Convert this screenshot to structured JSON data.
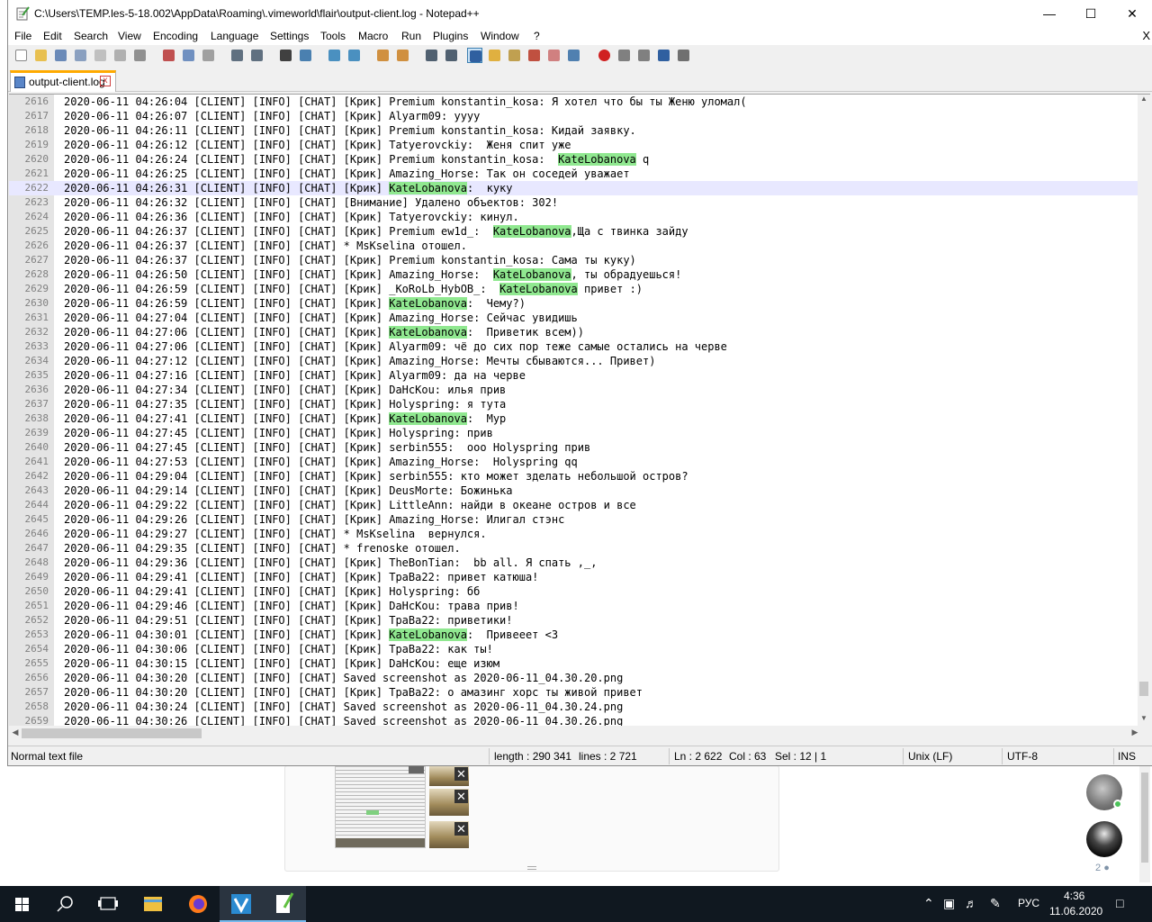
{
  "window": {
    "title": "C:\\Users\\TEMP.les-5-18.002\\AppData\\Roaming\\.vimeworld\\flair\\output-client.log - Notepad++",
    "minimize_glyph": "—",
    "maximize_glyph": "☐",
    "close_glyph": "✕"
  },
  "menu": {
    "items": [
      "File",
      "Edit",
      "Search",
      "View",
      "Encoding",
      "Language",
      "Settings",
      "Tools",
      "Macro",
      "Run",
      "Plugins",
      "Window",
      "?"
    ],
    "close_glyph": "X"
  },
  "tab": {
    "label": "output-client.log",
    "close_glyph": "x"
  },
  "editor": {
    "current_line": "2622",
    "lines": [
      {
        "n": "2616",
        "pre": "2020-06-11 04:26:04 [CLIENT] [INFO] [CHAT] [Крик] Premium konstantin_kosa: Я хотел что бы ты Женю уломал(",
        "hl": "",
        "post": ""
      },
      {
        "n": "2617",
        "pre": "2020-06-11 04:26:07 [CLIENT] [INFO] [CHAT] [Крик] Alyarm09: уууу",
        "hl": "",
        "post": ""
      },
      {
        "n": "2618",
        "pre": "2020-06-11 04:26:11 [CLIENT] [INFO] [CHAT] [Крик] Premium konstantin_kosa: Кидай заявку.",
        "hl": "",
        "post": ""
      },
      {
        "n": "2619",
        "pre": "2020-06-11 04:26:12 [CLIENT] [INFO] [CHAT] [Крик] Tatyerovckiy:  Женя спит уже",
        "hl": "",
        "post": ""
      },
      {
        "n": "2620",
        "pre": "2020-06-11 04:26:24 [CLIENT] [INFO] [CHAT] [Крик] Premium konstantin_kosa:  ",
        "hl": "KateLobanova",
        "post": " q"
      },
      {
        "n": "2621",
        "pre": "2020-06-11 04:26:25 [CLIENT] [INFO] [CHAT] [Крик] Amazing_Horse: Так он соседей уважает",
        "hl": "",
        "post": ""
      },
      {
        "n": "2622",
        "pre": "2020-06-11 04:26:31 [CLIENT] [INFO] [CHAT] [Крик] ",
        "hl": "KateLobanova",
        "post": ":  куку"
      },
      {
        "n": "2623",
        "pre": "2020-06-11 04:26:32 [CLIENT] [INFO] [CHAT] [Внимание] Удалено объектов: 302!",
        "hl": "",
        "post": ""
      },
      {
        "n": "2624",
        "pre": "2020-06-11 04:26:36 [CLIENT] [INFO] [CHAT] [Крик] Tatyerovckiy: кинул.",
        "hl": "",
        "post": ""
      },
      {
        "n": "2625",
        "pre": "2020-06-11 04:26:37 [CLIENT] [INFO] [CHAT] [Крик] Premium ew1d_:  ",
        "hl": "KateLobanova",
        "post": ",Ща с твинка зайду"
      },
      {
        "n": "2626",
        "pre": "2020-06-11 04:26:37 [CLIENT] [INFO] [CHAT] * MsKselina отошел.",
        "hl": "",
        "post": ""
      },
      {
        "n": "2627",
        "pre": "2020-06-11 04:26:37 [CLIENT] [INFO] [CHAT] [Крик] Premium konstantin_kosa: Сама ты куку)",
        "hl": "",
        "post": ""
      },
      {
        "n": "2628",
        "pre": "2020-06-11 04:26:50 [CLIENT] [INFO] [CHAT] [Крик] Amazing_Horse:  ",
        "hl": "KateLobanova",
        "post": ", ты обрадуешься!"
      },
      {
        "n": "2629",
        "pre": "2020-06-11 04:26:59 [CLIENT] [INFO] [CHAT] [Крик] _KoRoLb_HybOB_:  ",
        "hl": "KateLobanova",
        "post": " привет :)"
      },
      {
        "n": "2630",
        "pre": "2020-06-11 04:26:59 [CLIENT] [INFO] [CHAT] [Крик] ",
        "hl": "KateLobanova",
        "post": ":  Чему?)"
      },
      {
        "n": "2631",
        "pre": "2020-06-11 04:27:04 [CLIENT] [INFO] [CHAT] [Крик] Amazing_Horse: Сейчас увидишь",
        "hl": "",
        "post": ""
      },
      {
        "n": "2632",
        "pre": "2020-06-11 04:27:06 [CLIENT] [INFO] [CHAT] [Крик] ",
        "hl": "KateLobanova",
        "post": ":  Приветик всем))"
      },
      {
        "n": "2633",
        "pre": "2020-06-11 04:27:06 [CLIENT] [INFO] [CHAT] [Крик] Alyarm09: чё до сих пор теже самые остались на черве",
        "hl": "",
        "post": ""
      },
      {
        "n": "2634",
        "pre": "2020-06-11 04:27:12 [CLIENT] [INFO] [CHAT] [Крик] Amazing_Horse: Мечты сбываются... Привет)",
        "hl": "",
        "post": ""
      },
      {
        "n": "2635",
        "pre": "2020-06-11 04:27:16 [CLIENT] [INFO] [CHAT] [Крик] Alyarm09: да на черве",
        "hl": "",
        "post": ""
      },
      {
        "n": "2636",
        "pre": "2020-06-11 04:27:34 [CLIENT] [INFO] [CHAT] [Крик] DaHcKou: илья прив",
        "hl": "",
        "post": ""
      },
      {
        "n": "2637",
        "pre": "2020-06-11 04:27:35 [CLIENT] [INFO] [CHAT] [Крик] Holyspring: я тута",
        "hl": "",
        "post": ""
      },
      {
        "n": "2638",
        "pre": "2020-06-11 04:27:41 [CLIENT] [INFO] [CHAT] [Крик] ",
        "hl": "KateLobanova",
        "post": ":  Мур"
      },
      {
        "n": "2639",
        "pre": "2020-06-11 04:27:45 [CLIENT] [INFO] [CHAT] [Крик] Holyspring: прив",
        "hl": "",
        "post": ""
      },
      {
        "n": "2640",
        "pre": "2020-06-11 04:27:45 [CLIENT] [INFO] [CHAT] [Крик] serbin555:  ооо Holyspring прив",
        "hl": "",
        "post": ""
      },
      {
        "n": "2641",
        "pre": "2020-06-11 04:27:53 [CLIENT] [INFO] [CHAT] [Крик] Amazing_Horse:  Holyspring qq",
        "hl": "",
        "post": ""
      },
      {
        "n": "2642",
        "pre": "2020-06-11 04:29:04 [CLIENT] [INFO] [CHAT] [Крик] serbin555: кто может зделать небольшой остров?",
        "hl": "",
        "post": ""
      },
      {
        "n": "2643",
        "pre": "2020-06-11 04:29:14 [CLIENT] [INFO] [CHAT] [Крик] DeusMorte: Божинька",
        "hl": "",
        "post": ""
      },
      {
        "n": "2644",
        "pre": "2020-06-11 04:29:22 [CLIENT] [INFO] [CHAT] [Крик] LittleAnn: найди в океане остров и все",
        "hl": "",
        "post": ""
      },
      {
        "n": "2645",
        "pre": "2020-06-11 04:29:26 [CLIENT] [INFO] [CHAT] [Крик] Amazing_Horse: Илигал стэнс",
        "hl": "",
        "post": ""
      },
      {
        "n": "2646",
        "pre": "2020-06-11 04:29:27 [CLIENT] [INFO] [CHAT] * MsKselina  вернулся.",
        "hl": "",
        "post": ""
      },
      {
        "n": "2647",
        "pre": "2020-06-11 04:29:35 [CLIENT] [INFO] [CHAT] * frenoske отошел.",
        "hl": "",
        "post": ""
      },
      {
        "n": "2648",
        "pre": "2020-06-11 04:29:36 [CLIENT] [INFO] [CHAT] [Крик] TheBonTian:  bb all. Я спать ,_,",
        "hl": "",
        "post": ""
      },
      {
        "n": "2649",
        "pre": "2020-06-11 04:29:41 [CLIENT] [INFO] [CHAT] [Крик] ТраВа22: привет катюша!",
        "hl": "",
        "post": ""
      },
      {
        "n": "2650",
        "pre": "2020-06-11 04:29:41 [CLIENT] [INFO] [CHAT] [Крик] Holyspring: бб",
        "hl": "",
        "post": ""
      },
      {
        "n": "2651",
        "pre": "2020-06-11 04:29:46 [CLIENT] [INFO] [CHAT] [Крик] DaHcKou: трава прив!",
        "hl": "",
        "post": ""
      },
      {
        "n": "2652",
        "pre": "2020-06-11 04:29:51 [CLIENT] [INFO] [CHAT] [Крик] ТраВа22: приветики!",
        "hl": "",
        "post": ""
      },
      {
        "n": "2653",
        "pre": "2020-06-11 04:30:01 [CLIENT] [INFO] [CHAT] [Крик] ",
        "hl": "KateLobanova",
        "post": ":  Привееет <3"
      },
      {
        "n": "2654",
        "pre": "2020-06-11 04:30:06 [CLIENT] [INFO] [CHAT] [Крик] ТраВа22: как ты!",
        "hl": "",
        "post": ""
      },
      {
        "n": "2655",
        "pre": "2020-06-11 04:30:15 [CLIENT] [INFO] [CHAT] [Крик] DaHcKou: еще изюм",
        "hl": "",
        "post": ""
      },
      {
        "n": "2656",
        "pre": "2020-06-11 04:30:20 [CLIENT] [INFO] [CHAT] Saved screenshot as 2020-06-11_04.30.20.png",
        "hl": "",
        "post": ""
      },
      {
        "n": "2657",
        "pre": "2020-06-11 04:30:20 [CLIENT] [INFO] [CHAT] [Крик] ТраВа22: о амазинг хорс ты живой привет",
        "hl": "",
        "post": ""
      },
      {
        "n": "2658",
        "pre": "2020-06-11 04:30:24 [CLIENT] [INFO] [CHAT] Saved screenshot as 2020-06-11_04.30.24.png",
        "hl": "",
        "post": ""
      },
      {
        "n": "2659",
        "pre": "2020-06-11 04:30:26 [CLIENT] [INFO] [CHAT] Saved screenshot as 2020-06-11_04.30.26.png",
        "hl": "",
        "post": ""
      }
    ]
  },
  "status": {
    "file_type": "Normal text file",
    "length": "length : 290 341",
    "lines": "lines : 2 721",
    "ln": "Ln : 2 622",
    "col": "Col : 63",
    "sel": "Sel : 12 | 1",
    "eol": "Unix (LF)",
    "encoding": "UTF-8",
    "mode": "INS"
  },
  "background_app": {
    "member_count": "2",
    "close_glyph": "✕"
  },
  "taskbar": {
    "time": "4:36",
    "date": "11.06.2020",
    "language": "РУС",
    "apps": [
      "start-icon",
      "search-icon",
      "task-view-icon",
      "file-explorer-icon",
      "firefox-icon",
      "vimeworld-icon",
      "notepadpp-icon"
    ]
  },
  "colors": {
    "highlight": "#90e890",
    "current_line": "#e8e8ff",
    "taskbar": "#101820",
    "tab_accent": "#ffaa00"
  }
}
